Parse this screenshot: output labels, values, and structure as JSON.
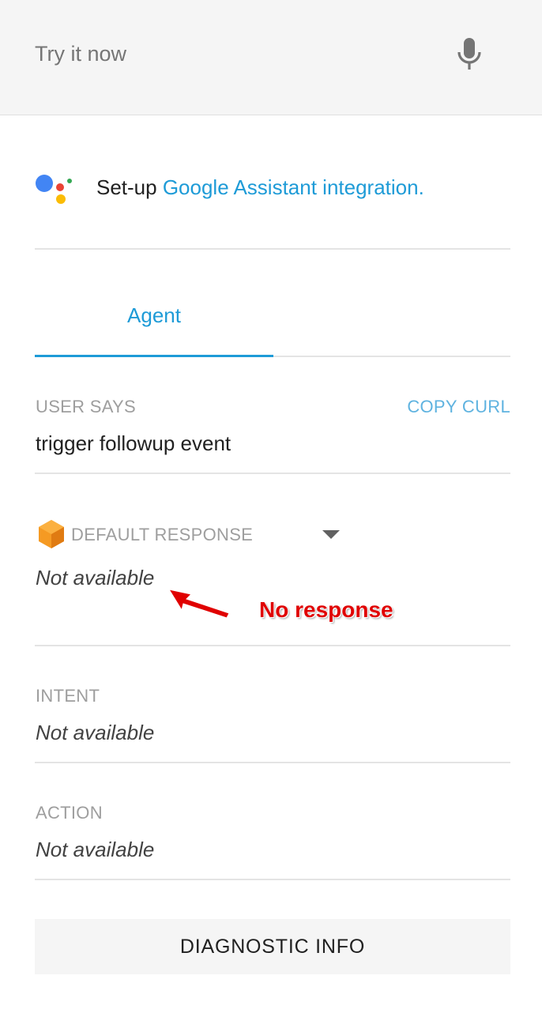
{
  "try_bar": {
    "placeholder": "Try it now",
    "mic_icon": "microphone-icon"
  },
  "setup": {
    "prefix": "Set-up ",
    "link": "Google Assistant integration.",
    "logo_icon": "google-assistant-logo-icon",
    "logo_colors": [
      "#4285f4",
      "#ea4335",
      "#fbbc05",
      "#34a853"
    ]
  },
  "tabs": [
    {
      "label": "Agent",
      "active": true
    }
  ],
  "user_says": {
    "label": "USER SAYS",
    "copy_curl": "COPY CURL",
    "value": "trigger followup event"
  },
  "default_response": {
    "label": "DEFAULT RESPONSE",
    "icon": "cube-icon",
    "dropdown_icon": "caret-down-icon",
    "value": "Not available"
  },
  "annotation": {
    "text": "No response",
    "color": "#e00000",
    "arrow_icon": "red-arrow-icon"
  },
  "intent": {
    "label": "INTENT",
    "value": "Not available"
  },
  "action": {
    "label": "ACTION",
    "value": "Not available"
  },
  "diagnostic_button": "DIAGNOSTIC INFO",
  "colors": {
    "accent": "#1e9bd7",
    "topbar_bg": "#f5f5f5",
    "button_bg": "#f5f5f5",
    "label_gray": "#9e9e9e"
  }
}
